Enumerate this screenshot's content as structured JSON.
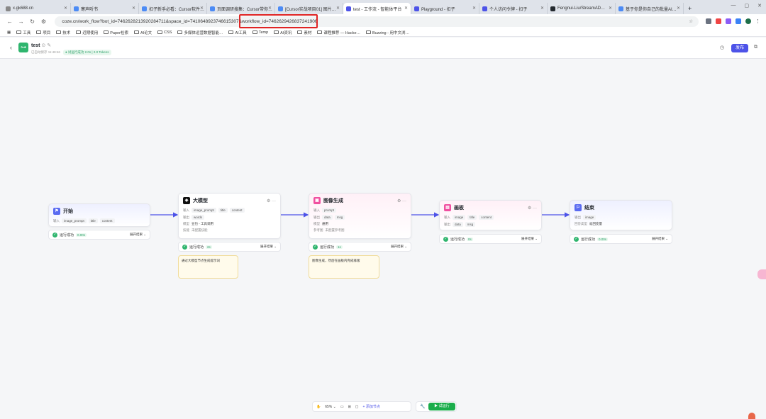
{
  "tabs": [
    {
      "label": "x.gk688.cn",
      "color": "#888888"
    },
    {
      "label": "寒声听书",
      "color": "#4c8bf5"
    },
    {
      "label": "扣子新手必看：Cursor软件…",
      "color": "#4c8bf5"
    },
    {
      "label": "页面调研搜集：Cursor带你…",
      "color": "#4c8bf5"
    },
    {
      "label": "[Cursor实战项目01] 图片…",
      "color": "#4c8bf5"
    },
    {
      "label": "test - 工作流 - 智能体平台",
      "color": "#4d53e8",
      "active": true
    },
    {
      "label": "Playground - 扣子",
      "color": "#4d53e8"
    },
    {
      "label": "个人访问令牌 - 扣子",
      "color": "#4d53e8"
    },
    {
      "label": "Fengnui-Liu/StreamAD…",
      "color": "#24292f"
    },
    {
      "label": "基于你是你自己的批量AI…",
      "color": "#4c8bf5"
    }
  ],
  "url": {
    "prefix": "coze.cn/work_flow?bot_id=7462628213920284711&space_id=7410648923746615307&",
    "highlight": "workflow_id=7462629426837241906"
  },
  "bookmarks": [
    "工具",
    "项目",
    "技术",
    "近期使用",
    "Paper检索",
    "AI论文",
    "CSS",
    "多媒体运营数据智能…",
    "AI工具",
    "Temp",
    "AI资讯",
    "素材",
    "课程推荐 — Hacke…",
    "Buzzing - 用中文浏…"
  ],
  "header": {
    "title": "test",
    "autosave": "已自动保存 11:48:46",
    "run_status": "试运行成功 2.0s | 2.0 Tokens",
    "publish": "发布"
  },
  "nodes": {
    "start": {
      "title": "开始",
      "input_label": "输入",
      "inputs": [
        "image_prompt",
        "title",
        "content"
      ],
      "status": "运行成功",
      "duration": "0.00s",
      "expand": "展开结果 ⌄"
    },
    "llm": {
      "title": "大模型",
      "input_label": "输入",
      "inputs": [
        "image_prompt",
        "title",
        "content"
      ],
      "output_label": "输出",
      "outputs": [
        "words"
      ],
      "model_label": "模型",
      "model": "豆包 - 工具调用",
      "skill_label": "技能",
      "skill": "未配置技能",
      "status": "运行成功",
      "duration": "2s",
      "expand": "展开结果 ⌄",
      "note": "通过大模型节点生成提示词"
    },
    "image": {
      "title": "图像生成",
      "input_label": "输入",
      "inputs": [
        "prompt"
      ],
      "output_label": "输出",
      "outputs": [
        "data",
        "msg"
      ],
      "model_label": "模型",
      "model": "通用",
      "ref_label": "参考图",
      "ref": "未配置参考图",
      "status": "运行成功",
      "duration": "1s",
      "expand": "展开结果 ⌄",
      "note": "图像生成，然后在画板内完成排版"
    },
    "canvas": {
      "title": "画板",
      "input_label": "输入",
      "inputs": [
        "image",
        "title",
        "content"
      ],
      "output_label": "输出",
      "outputs": [
        "data",
        "msg"
      ],
      "status": "运行成功",
      "duration": "0s",
      "expand": "展开结果 ⌄"
    },
    "end": {
      "title": "结束",
      "output_label": "输出",
      "outputs": [
        "image"
      ],
      "answer_label": "回答类型",
      "answer": "返回变量",
      "status": "运行成功",
      "duration": "0.00s",
      "expand": "展开结果 ⌄"
    }
  },
  "toolbar": {
    "zoom": "65%",
    "add_node": "+ 添加节点",
    "test_run": "▶ 试运行"
  }
}
